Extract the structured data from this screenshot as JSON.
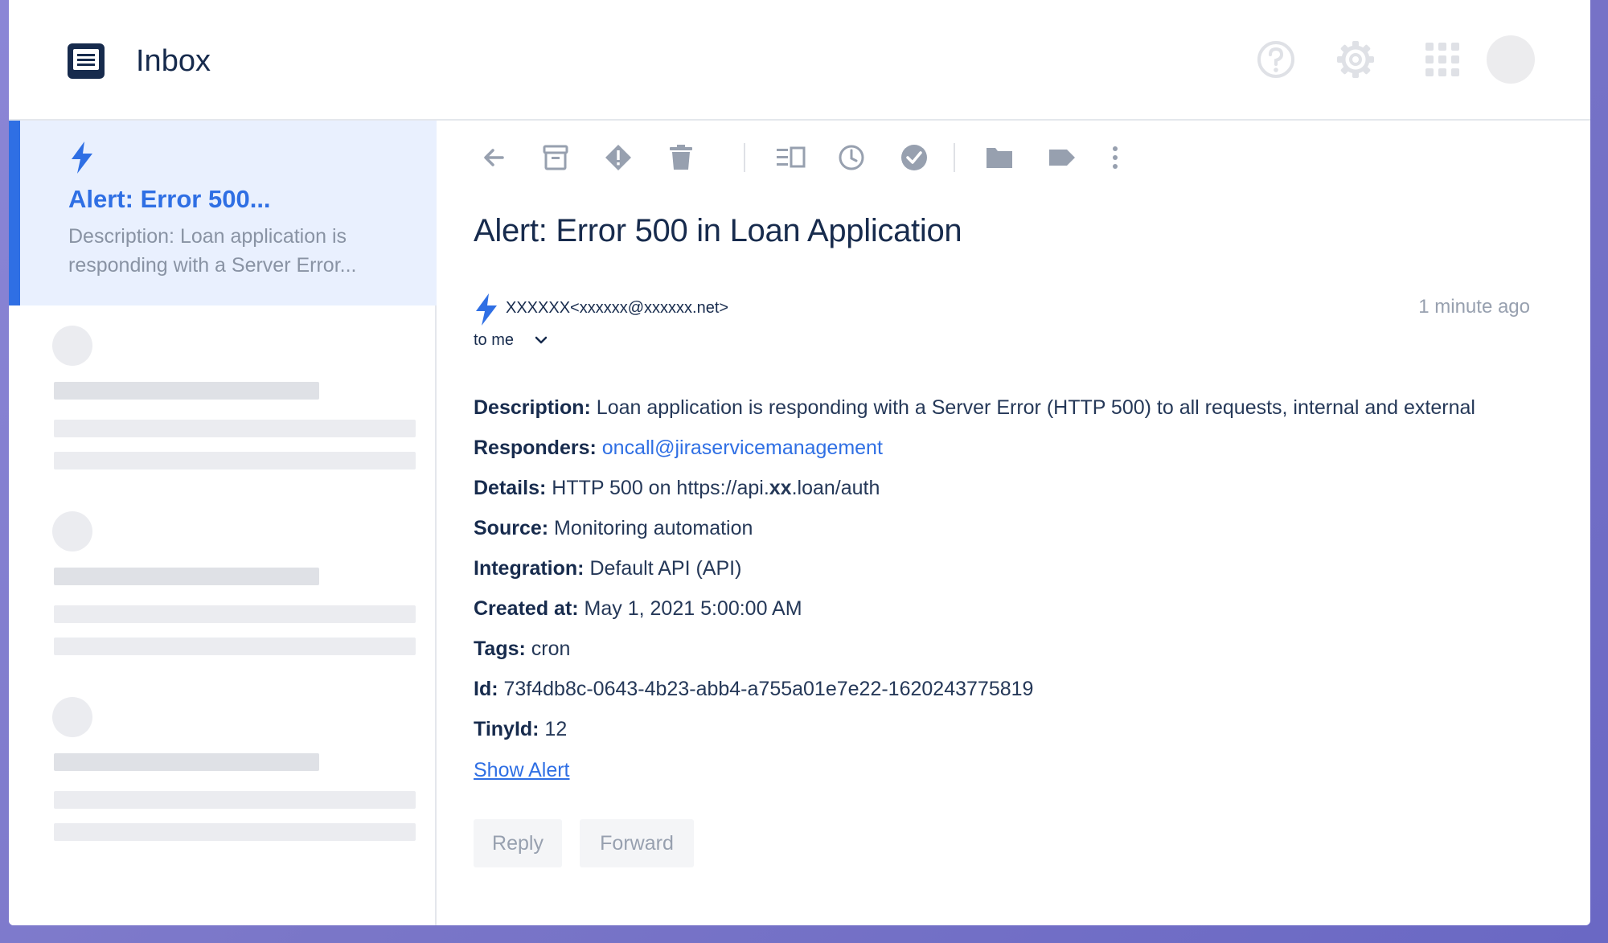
{
  "header": {
    "title": "Inbox",
    "icons": [
      "inbox-icon",
      "help-icon",
      "settings-icon",
      "apps-grid-icon",
      "avatar"
    ]
  },
  "sidebar": {
    "selected_item": {
      "title": "Alert: Error 500...",
      "snippet": "Description: Loan application is responding with a Server Error...",
      "icon": "lightning-bolt-icon"
    },
    "placeholder_items": 3
  },
  "toolbar": {
    "icons": [
      "back-arrow-icon",
      "archive-icon",
      "spam-icon",
      "trash-icon",
      "split-view-icon",
      "snooze-clock-icon",
      "done-check-icon",
      "move-folder-icon",
      "label-tag-icon",
      "more-options-icon"
    ]
  },
  "email": {
    "subject": "Alert: Error 500 in Loan Application",
    "sender": "XXXXXX<xxxxxx@xxxxxx.net>",
    "recipient": "to me",
    "time": "1 minute ago",
    "fields": [
      {
        "label": "Description:",
        "value": " Loan application is responding with a Server Error (HTTP 500) to all requests, internal and external"
      },
      {
        "label": "Responders:",
        "value": " ",
        "link": "oncall@jiraservicemanagement"
      },
      {
        "label": "Details:",
        "value": " HTTP 500 on https://api.",
        "strong": "xx",
        "value2": ".loan/auth"
      },
      {
        "label": "Source:",
        "value": " Monitoring automation"
      },
      {
        "label": "Integration:",
        "value": " Default API (API)"
      },
      {
        "label": "Created at:",
        "value": " May 1, 2021 5:00:00 AM"
      },
      {
        "label": "Tags:",
        "value": " cron"
      },
      {
        "label": "Id:",
        "value": " 73f4db8c-0643-4b23-abb4-a755a01e7e22-1620243775819"
      },
      {
        "label": "TinyId:",
        "value": " 12"
      }
    ],
    "show_alert": "Show Alert",
    "reply_label": "Reply",
    "forward_label": "Forward"
  },
  "colors": {
    "accent": "#2f6fe4",
    "heading": "#172b4d",
    "muted": "#97a0af",
    "selected_bg": "#e9f0fe"
  }
}
